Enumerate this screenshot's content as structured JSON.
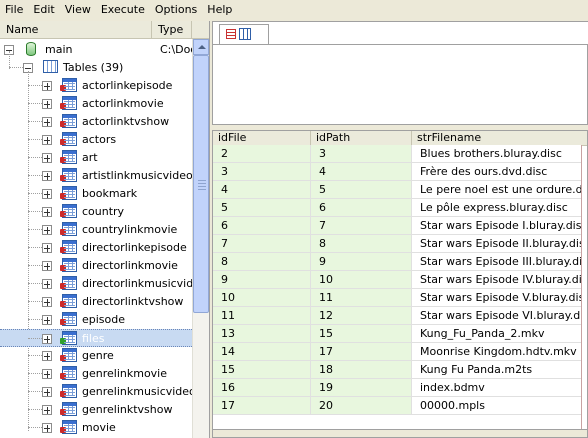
{
  "menu": [
    "File",
    "Edit",
    "View",
    "Execute",
    "Options",
    "Help"
  ],
  "tree": {
    "header": {
      "name": "Name",
      "type": "Type"
    },
    "db": {
      "label": "main",
      "type": "C:\\Doc"
    },
    "tables_group": "Tables (39)",
    "tables": [
      "actorlinkepisode",
      "actorlinkmovie",
      "actorlinktvshow",
      "actors",
      "art",
      "artistlinkmusicvideo",
      "bookmark",
      "country",
      "countrylinkmovie",
      "directorlinkepisode",
      "directorlinkmovie",
      "directorlinkmusicvideo",
      "directorlinktvshow",
      "episode",
      "files",
      "genre",
      "genrelinkmovie",
      "genrelinkmusicvideo",
      "genrelinktvshow",
      "movie"
    ],
    "selected": "files",
    "green_icons": [
      "files"
    ]
  },
  "grid": {
    "columns": [
      "idFile",
      "idPath",
      "strFilename"
    ],
    "rows": [
      [
        "2",
        "3",
        "Blues brothers.bluray.disc"
      ],
      [
        "3",
        "4",
        "Frère des ours.dvd.disc"
      ],
      [
        "4",
        "5",
        "Le pere noel est une ordure.d..."
      ],
      [
        "5",
        "6",
        "Le pôle express.bluray.disc"
      ],
      [
        "6",
        "7",
        "Star wars Episode I.bluray.disc"
      ],
      [
        "7",
        "8",
        "Star wars Episode II.bluray.disc"
      ],
      [
        "8",
        "9",
        "Star wars Episode III.bluray.disc"
      ],
      [
        "9",
        "10",
        "Star wars Episode IV.bluray.disc"
      ],
      [
        "10",
        "11",
        "Star wars Episode V.bluray.disc"
      ],
      [
        "11",
        "12",
        "Star wars Episode VI.bluray.disc"
      ],
      [
        "13",
        "15",
        "Kung_Fu_Panda_2.mkv"
      ],
      [
        "14",
        "17",
        "Moonrise Kingdom.hdtv.mkv"
      ],
      [
        "15",
        "18",
        "Kung Fu Panda.m2ts"
      ],
      [
        "16",
        "19",
        "index.bdmv"
      ],
      [
        "17",
        "20",
        "00000.mpls"
      ]
    ]
  },
  "icons": {
    "database": "database-icon",
    "table": "table-icon",
    "tab": "grid-view-icon"
  }
}
